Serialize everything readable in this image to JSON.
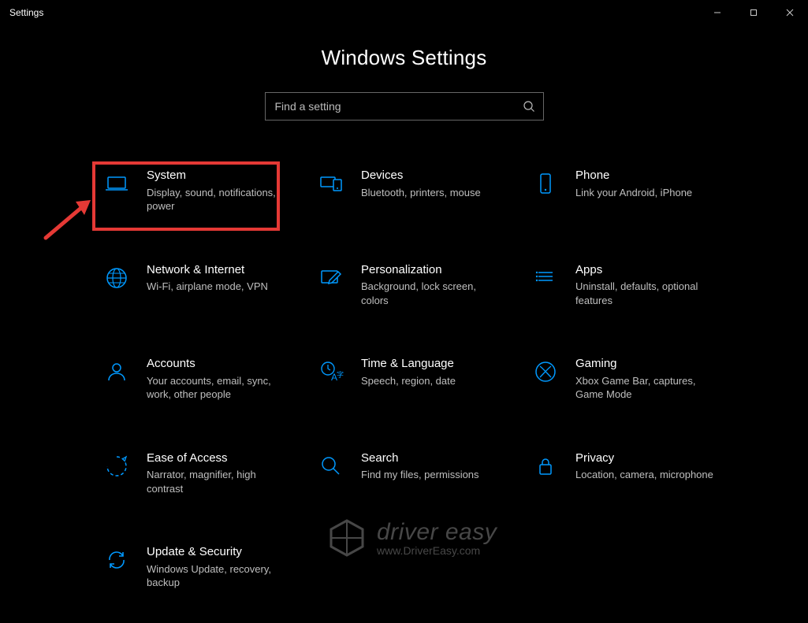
{
  "window": {
    "title": "Settings",
    "minimize": "—",
    "maximize": "□",
    "close": "✕"
  },
  "page": {
    "title": "Windows Settings",
    "search": {
      "placeholder": "Find a setting",
      "value": ""
    }
  },
  "colors": {
    "accent": "#0099ff",
    "highlight": "#e53935"
  },
  "categories": [
    {
      "title": "System",
      "desc": "Display, sound, notifications, power",
      "icon": "laptop"
    },
    {
      "title": "Devices",
      "desc": "Bluetooth, printers, mouse",
      "icon": "devices"
    },
    {
      "title": "Phone",
      "desc": "Link your Android, iPhone",
      "icon": "phone"
    },
    {
      "title": "Network & Internet",
      "desc": "Wi-Fi, airplane mode, VPN",
      "icon": "globe"
    },
    {
      "title": "Personalization",
      "desc": "Background, lock screen, colors",
      "icon": "pen"
    },
    {
      "title": "Apps",
      "desc": "Uninstall, defaults, optional features",
      "icon": "apps"
    },
    {
      "title": "Accounts",
      "desc": "Your accounts, email, sync, work, other people",
      "icon": "person"
    },
    {
      "title": "Time & Language",
      "desc": "Speech, region, date",
      "icon": "time-lang"
    },
    {
      "title": "Gaming",
      "desc": "Xbox Game Bar, captures, Game Mode",
      "icon": "xbox"
    },
    {
      "title": "Ease of Access",
      "desc": "Narrator, magnifier, high contrast",
      "icon": "ease"
    },
    {
      "title": "Search",
      "desc": "Find my files, permissions",
      "icon": "search-big"
    },
    {
      "title": "Privacy",
      "desc": "Location, camera, microphone",
      "icon": "lock"
    },
    {
      "title": "Update & Security",
      "desc": "Windows Update, recovery, backup",
      "icon": "update"
    }
  ],
  "highlight": {
    "index": 0
  },
  "watermark": {
    "main": "driver",
    "main2": " easy",
    "sub": "www.DriverEasy.com"
  }
}
